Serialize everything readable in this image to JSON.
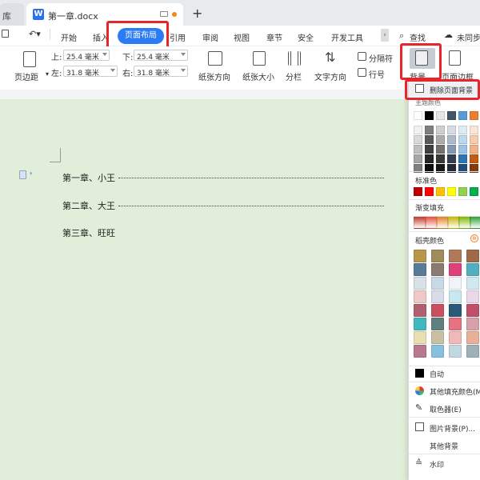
{
  "tabs": {
    "prev_label": "库",
    "doc_icon": "W",
    "doc_name": "第一章.docx",
    "add": "+"
  },
  "menu": {
    "items": [
      "开始",
      "插入",
      "页面布局",
      "引用",
      "审阅",
      "视图",
      "章节",
      "安全",
      "开发工具"
    ],
    "active_index": 2,
    "search": "查找",
    "sync": "未同步"
  },
  "ribbon": {
    "margins_label": "页边距",
    "top_label": "上:",
    "top_value": "25.4 毫米",
    "bottom_label": "下:",
    "bottom_value": "25.4 毫米",
    "left_label": "左:",
    "left_value": "31.8 毫米",
    "right_label": "右:",
    "right_value": "31.8 毫米",
    "orientation": "纸张方向",
    "size": "纸张大小",
    "columns": "分栏",
    "text_direction": "文字方向",
    "separator": "分隔符",
    "line_number": "行号",
    "background": "背景",
    "page_border": "页面边框"
  },
  "document": {
    "toc": [
      "第一章、小王",
      "第二章、大王",
      "第三章、旺旺"
    ]
  },
  "dropdown": {
    "remove_bg": "删除页面背景",
    "theme_colors_label": "主题颜色",
    "standard_colors_label": "标准色",
    "gradient_label": "渐变填充",
    "shell_colors_label": "稻壳颜色",
    "auto": "自动",
    "more_fill": "其他填充颜色(M)",
    "eyedropper": "取色器(E)",
    "picture_bg": "图片背景(P)...",
    "other_bg": "其他背景",
    "watermark": "水印",
    "theme_top": [
      "#ffffff",
      "#000000",
      "#e7e6e6",
      "#44546a",
      "#5b9bd5",
      "#ed7d31"
    ],
    "theme_grid": [
      [
        "#f2f2f2",
        "#7f7f7f",
        "#d0cece",
        "#d6dce5",
        "#deebf7",
        "#fbe5d6"
      ],
      [
        "#d9d9d9",
        "#595959",
        "#aeabab",
        "#adb9ca",
        "#bdd7ee",
        "#f8cbad"
      ],
      [
        "#bfbfbf",
        "#3f3f3f",
        "#757171",
        "#8497b0",
        "#9dc3e6",
        "#f4b183"
      ],
      [
        "#a6a6a6",
        "#262626",
        "#3b3838",
        "#333f50",
        "#2e75b6",
        "#c55a11"
      ],
      [
        "#808080",
        "#0d0d0d",
        "#181717",
        "#222a35",
        "#1f4e79",
        "#843c0c"
      ]
    ],
    "standard": [
      "#c00000",
      "#ff0000",
      "#ffc000",
      "#ffff00",
      "#92d050",
      "#00b050"
    ],
    "gradient": [
      "#c0392b",
      "#e74c3c",
      "#e67e22",
      "#c8b400",
      "#7ab800",
      "#2e9e3a"
    ],
    "shell_grid": [
      [
        "#b8964a",
        "#a08c5a",
        "#b07a5a",
        "#a06a4a"
      ],
      [
        "#5a7a9a",
        "#8a7a70",
        "#e0407a",
        "#50b0c0"
      ],
      [
        "#d8e0e8",
        "#c8d8e4",
        "#f0f4f8",
        "#d0e8f0"
      ],
      [
        "#f0c8c8",
        "#d8dce8",
        "#c8e8f0",
        "#e8d8e8"
      ],
      [
        "#b06070",
        "#c85060",
        "#2a5a78",
        "#c0506a"
      ],
      [
        "#40b8c0",
        "#608080",
        "#e87080",
        "#d8a0a8"
      ],
      [
        "#e8e0b0",
        "#c8c0a0",
        "#f0b8b8",
        "#e8b098"
      ],
      [
        "#b87890",
        "#88c0e0",
        "#c0d8e0",
        "#a0b0b8"
      ]
    ]
  }
}
